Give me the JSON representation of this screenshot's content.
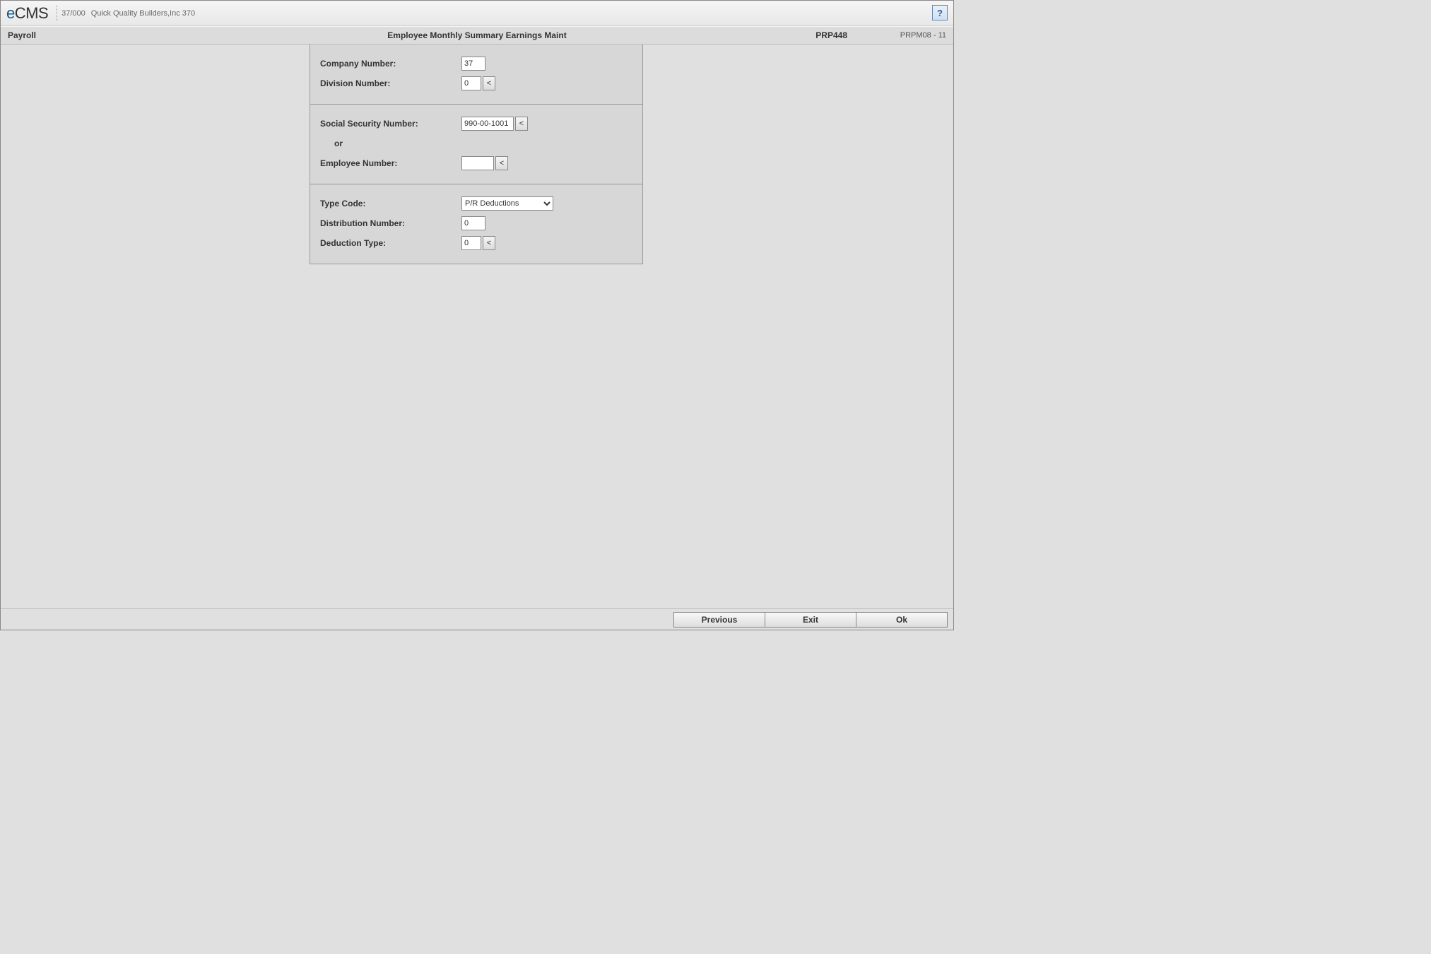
{
  "titlebar": {
    "logo_e": "e",
    "logo_cms": "CMS",
    "company_code": "37/000",
    "company_name": "Quick Quality Builders,Inc 370",
    "help_glyph": "?"
  },
  "subheader": {
    "module": "Payroll",
    "title": "Employee Monthly Summary Earnings Maint",
    "code1": "PRP448",
    "code2": "PRPM08 - 11"
  },
  "form": {
    "section1": {
      "company_label": "Company Number:",
      "company_value": "37",
      "division_label": "Division Number:",
      "division_value": "0"
    },
    "section2": {
      "ssn_label": "Social Security Number:",
      "ssn_value": "990-00-1001",
      "or_label": "or",
      "emp_label": "Employee Number:",
      "emp_value": ""
    },
    "section3": {
      "type_label": "Type Code:",
      "type_value": "P/R Deductions",
      "dist_label": "Distribution Number:",
      "dist_value": "0",
      "ded_label": "Deduction Type:",
      "ded_value": "0"
    }
  },
  "lookup_glyph": "<",
  "footer": {
    "previous": "Previous",
    "exit": "Exit",
    "ok": "Ok"
  }
}
